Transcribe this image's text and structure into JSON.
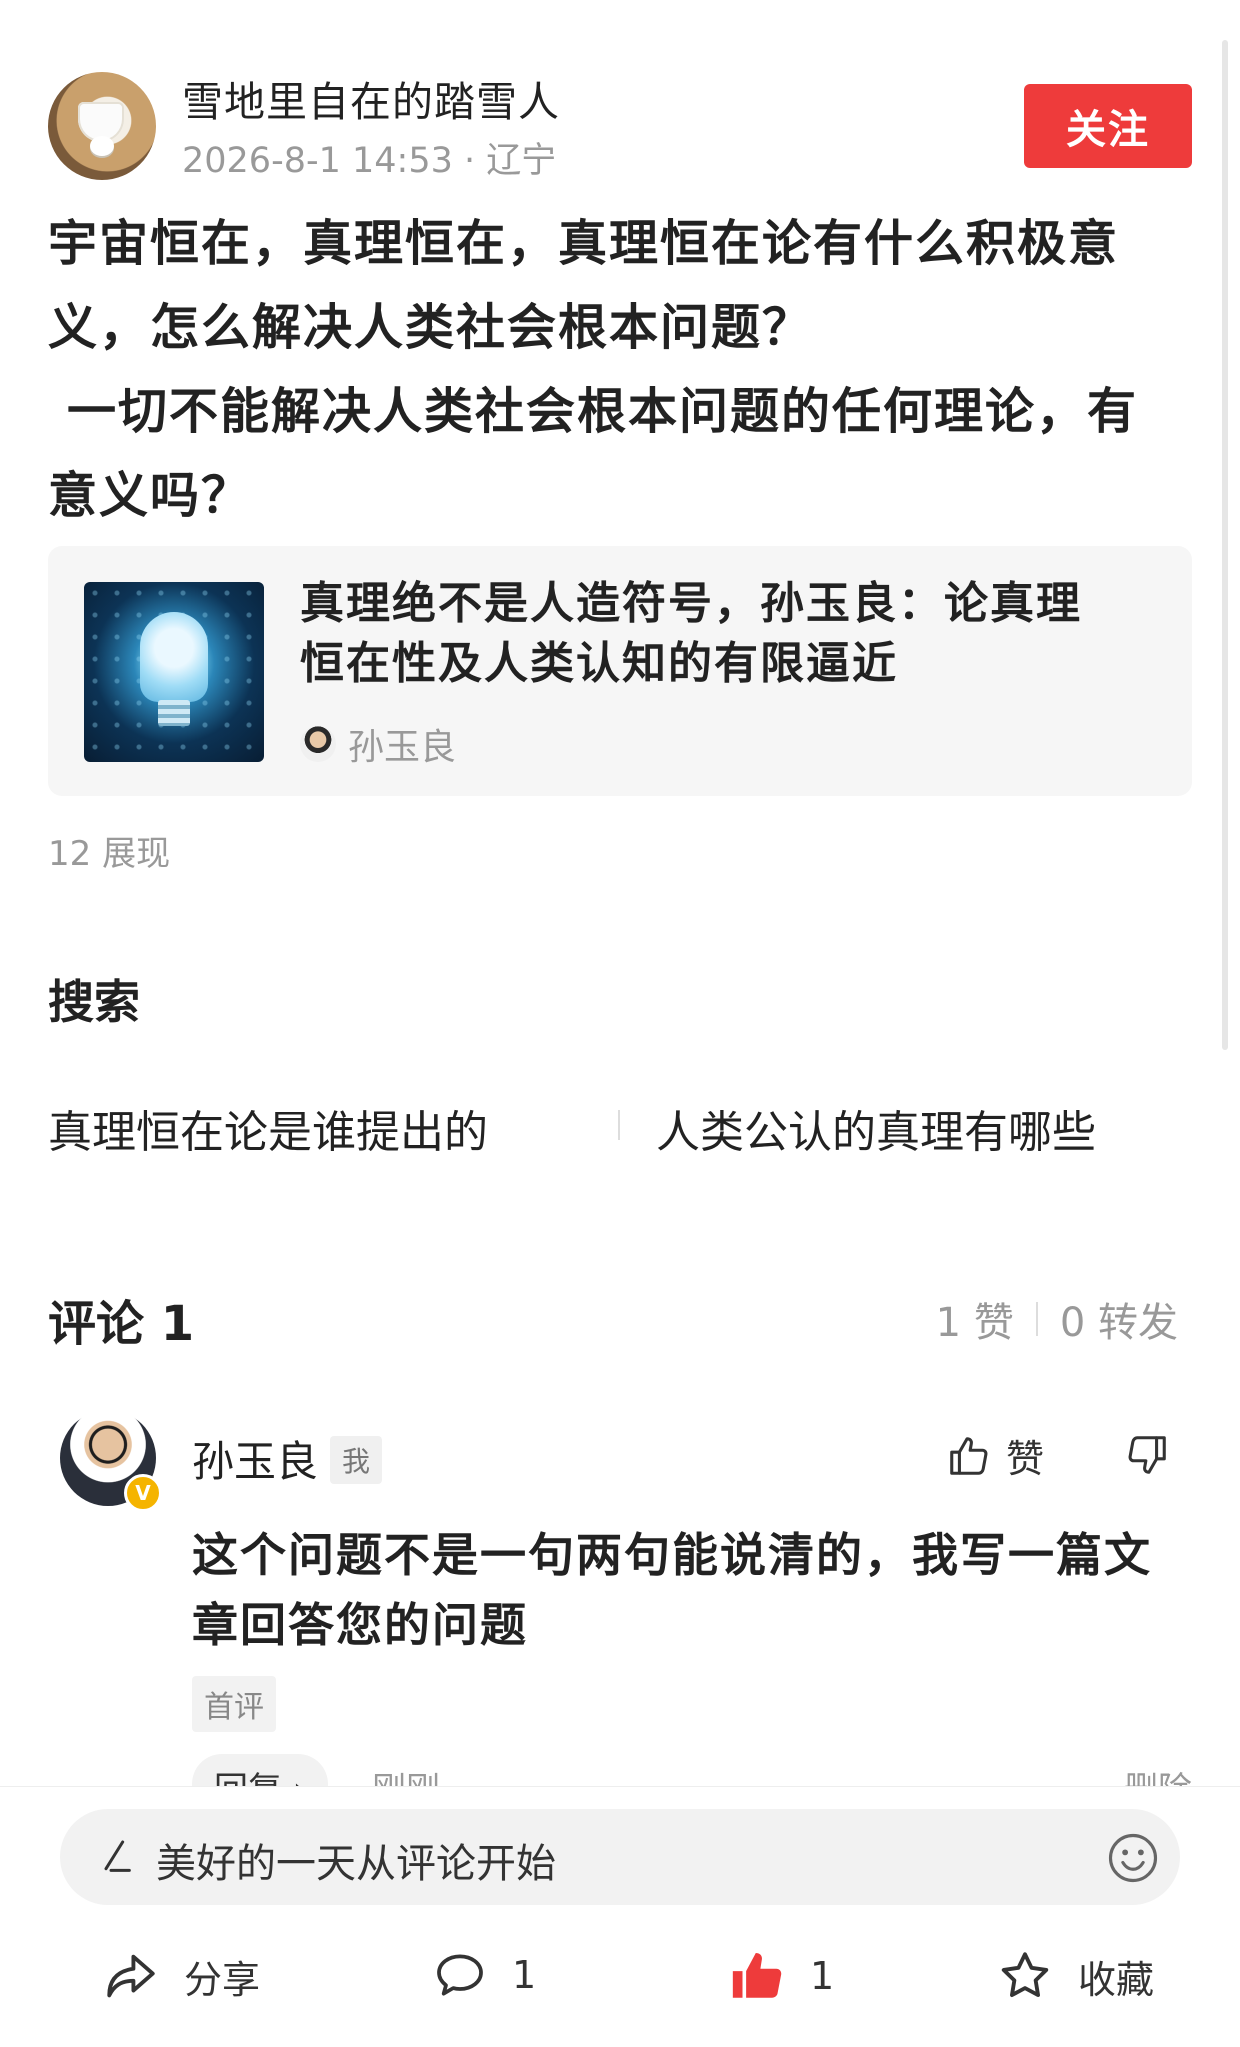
{
  "author": {
    "name": "雪地里自在的踏雪人",
    "meta": "2026-8-1 14:53 · 辽宁",
    "follow_label": "关注"
  },
  "post": {
    "lines": [
      "宇宙恒在，真理恒在，真理恒在论有什么积极意",
      "义，怎么解决人类社会根本问题？",
      " 一切不能解决人类社会根本问题的任何理论，有",
      "意义吗？"
    ]
  },
  "linked_article": {
    "title_line1": "真理绝不是人造符号，孙玉良：论真理",
    "title_line2": "恒在性及人类认知的有限逼近",
    "author": "孙玉良"
  },
  "impressions": "12 展现",
  "search": {
    "heading": "搜索",
    "items": [
      "真理恒在论是谁提出的",
      "人类公认的真理有哪些"
    ]
  },
  "comments": {
    "title": "评论 1",
    "likes": "1 赞",
    "reposts": "0 转发",
    "items": [
      {
        "name": "孙玉良",
        "me_tag": "我",
        "badge": "V",
        "like_label": "赞",
        "line1": "这个问题不是一句两句能说清的，我写一篇文",
        "line2": "章回答您的问题",
        "tag": "首评",
        "reply_label": "回复 ›",
        "time": "刚刚",
        "delete_label": "删除"
      }
    ]
  },
  "bottom_bar": {
    "input_placeholder": "美好的一天从评论开始",
    "share_label": "分享",
    "comment_count": "1",
    "like_count": "1",
    "favorite_label": "收藏"
  },
  "colors": {
    "accent_red": "#ee3b3b",
    "muted_text": "#999999",
    "badge_gold": "#f5b400"
  }
}
